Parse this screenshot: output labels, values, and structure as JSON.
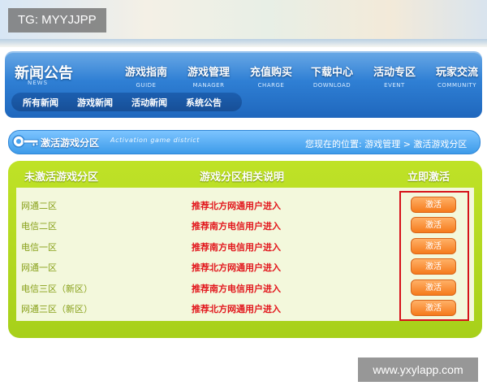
{
  "watermark_top": "TG: MYYJJPP",
  "watermark_bottom": "www.yxylapp.com",
  "nav": {
    "brand": "新闻公告",
    "brand_en": "NEWS",
    "items": [
      {
        "label": "游戏指南",
        "en": "GUIDE"
      },
      {
        "label": "游戏管理",
        "en": "MANAGER"
      },
      {
        "label": "充值购买",
        "en": "CHARGE"
      },
      {
        "label": "下载中心",
        "en": "DOWNLOAD"
      },
      {
        "label": "活动专区",
        "en": "EVENT"
      },
      {
        "label": "玩家交流",
        "en": "COMMUNITY"
      }
    ],
    "sub_items": [
      "所有新闻",
      "游戏新闻",
      "活动新闻",
      "系统公告"
    ]
  },
  "section": {
    "title": "激活游戏分区",
    "title_en": "Activation game district",
    "breadcrumb": "您现在的位置: 游戏管理 > 激活游戏分区"
  },
  "table": {
    "headers": [
      "未激活游戏分区",
      "游戏分区相关说明",
      "立即激活"
    ],
    "rows": [
      {
        "name": "网通二区",
        "desc": "推荐北方网通用户进入",
        "action": "激活"
      },
      {
        "name": "电信二区",
        "desc": "推荐南方电信用户进入",
        "action": "激活"
      },
      {
        "name": "电信一区",
        "desc": "推荐南方电信用户进入",
        "action": "激活"
      },
      {
        "name": "网通一区",
        "desc": "推荐北方网通用户进入",
        "action": "激活"
      },
      {
        "name": "电信三区（新区）",
        "desc": "推荐南方电信用户进入",
        "action": "激活"
      },
      {
        "name": "网通三区（新区）",
        "desc": "推荐北方网通用户进入",
        "action": "激活"
      }
    ]
  },
  "colors": {
    "nav_blue": "#2f7fd4",
    "panel_green": "#a7d01a",
    "desc_red": "#e2161c",
    "button_orange": "#f57a1c",
    "highlight_red": "#d6121a"
  }
}
